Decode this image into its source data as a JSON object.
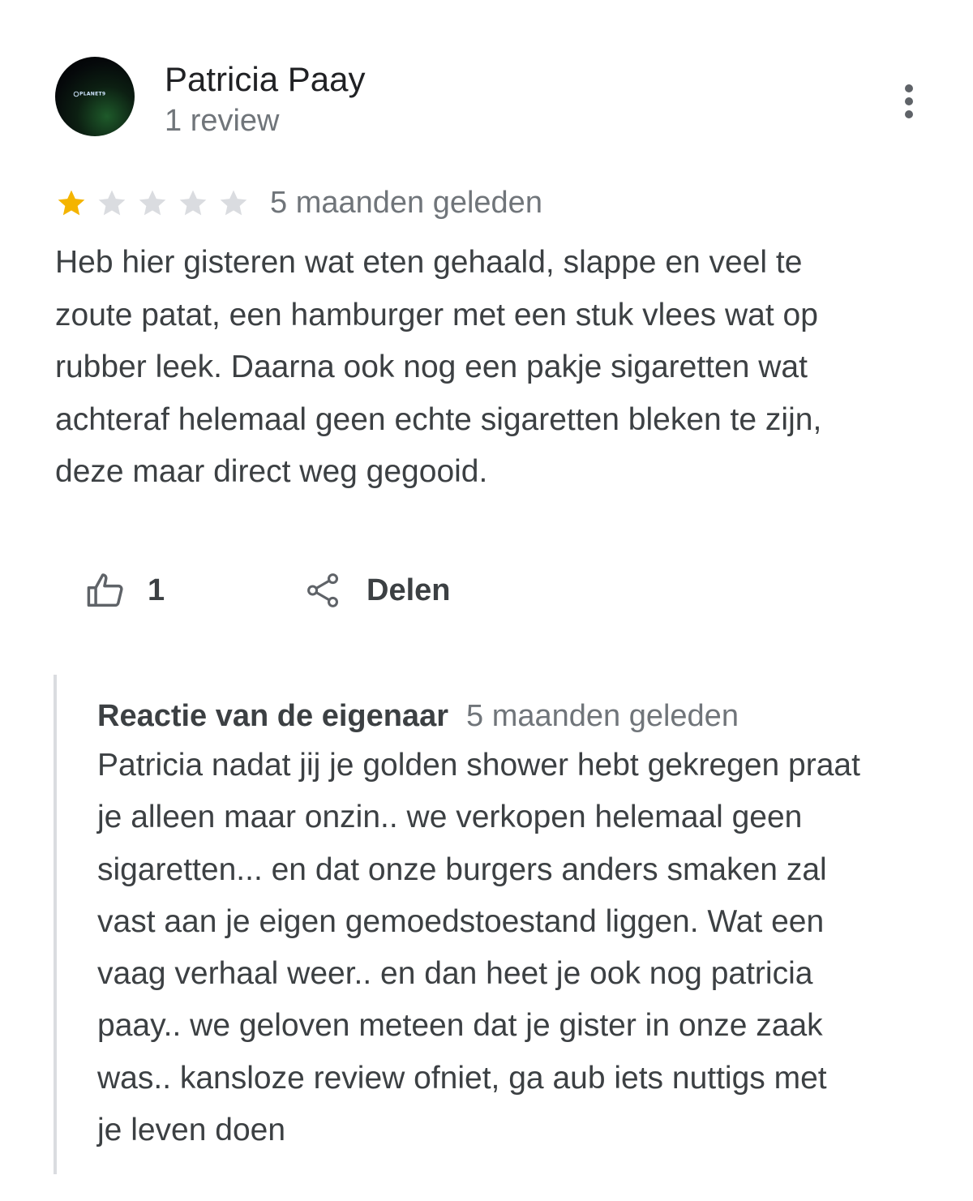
{
  "reviewer": {
    "name": "Patricia Paay",
    "review_count": "1 review",
    "avatar_logo_text": "PLANET9"
  },
  "review": {
    "rating": 1,
    "max_rating": 5,
    "date": "5 maanden geleden",
    "text_lines": [
      "Heb hier gisteren wat eten gehaald, slappe en veel te",
      "zoute patat, een hamburger met een stuk vlees wat op",
      "rubber leek. Daarna ook nog een pakje sigaretten wat",
      "achteraf helemaal geen echte sigaretten bleken te zijn,",
      "deze maar direct weg gegooid."
    ]
  },
  "actions": {
    "like_count": "1",
    "share_label": "Delen"
  },
  "owner_response": {
    "title": "Reactie van de eigenaar",
    "date": "5 maanden geleden",
    "text_lines": [
      "Patricia nadat jij je golden shower hebt gekregen praat",
      "je alleen maar onzin.. we verkopen helemaal geen",
      "sigaretten... en dat onze burgers anders smaken zal",
      "vast aan je eigen gemoedstoestand liggen. Wat een",
      "vaag verhaal weer.. en dan heet je ook nog patricia",
      "paay.. we geloven meteen dat je gister in onze zaak",
      "was.. kansloze review ofniet, ga aub iets nuttigs met",
      "je leven doen"
    ]
  },
  "colors": {
    "star_filled": "#f4b400",
    "star_empty": "#dadce0",
    "secondary_text": "#70757a",
    "body_text": "#3c4043",
    "icon": "#5f6368"
  },
  "icons": {
    "more": "more-vert-icon",
    "like": "thumb-up-icon",
    "share": "share-icon",
    "star": "star-icon"
  }
}
